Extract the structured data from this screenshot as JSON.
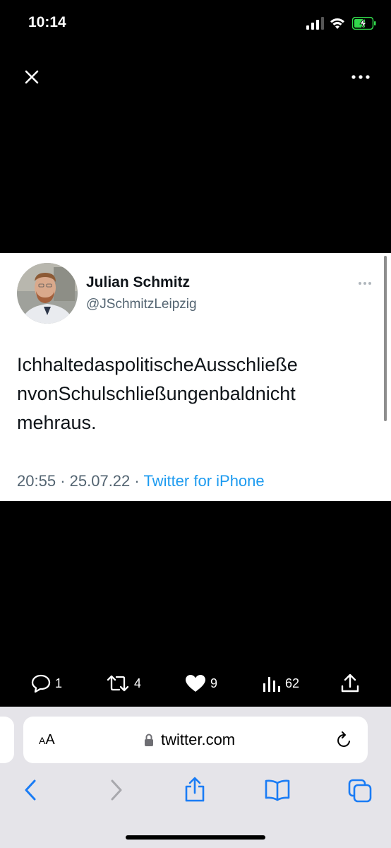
{
  "status_bar": {
    "time": "10:14",
    "battery_charging": true
  },
  "tweet": {
    "display_name": "Julian Schmitz",
    "handle": "@JSchmitzLeipzig",
    "text": "IchhaltedaspolitischeAusschließenvonSchulschließungenbaldnichtmehraus.",
    "text_lines": [
      "IchhaltedaspolitischeAusschließe",
      "nvonSchulschließungenbaldnicht",
      "mehraus."
    ],
    "time": "20:55",
    "date": "25.07.22",
    "separator": "·",
    "source": "Twitter for iPhone"
  },
  "actions": {
    "replies": "1",
    "retweets": "4",
    "likes": "9",
    "views": "62"
  },
  "browser": {
    "aa_label_small": "A",
    "aa_label_large": "A",
    "url": "twitter.com"
  },
  "colors": {
    "accent": "#1d9bf0",
    "safari_blue": "#1a7cf5",
    "safari_bg": "#e5e4e9",
    "muted_text": "#536471"
  },
  "icons": [
    "signal-icon",
    "wifi-icon",
    "battery-icon",
    "close-icon",
    "more-icon",
    "reply-icon",
    "retweet-icon",
    "like-icon",
    "views-icon",
    "share-icon",
    "lock-icon",
    "reload-icon",
    "back-icon",
    "forward-icon",
    "share-sheet-icon",
    "bookmarks-icon",
    "tabs-icon"
  ]
}
